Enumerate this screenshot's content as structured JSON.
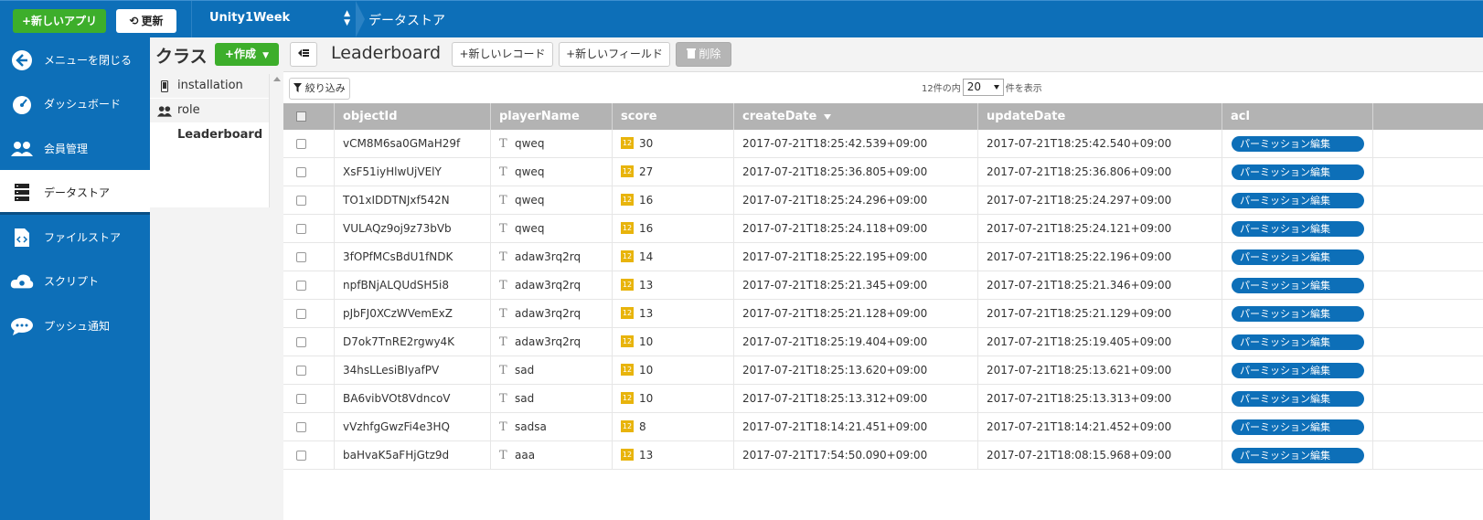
{
  "topbar": {
    "new_app_label": "+新しいアプリ",
    "refresh_label": "更新",
    "app_name": "Unity1Week",
    "breadcrumb": "データストア"
  },
  "sidebar": {
    "items": [
      {
        "label": "メニューを閉じる",
        "icon": "arrow-left-circle-icon"
      },
      {
        "label": "ダッシュボード",
        "icon": "gauge-icon"
      },
      {
        "label": "会員管理",
        "icon": "users-icon"
      },
      {
        "label": "データストア",
        "icon": "database-icon",
        "active": true
      },
      {
        "label": "ファイルストア",
        "icon": "file-code-icon"
      },
      {
        "label": "スクリプト",
        "icon": "cloud-gear-icon"
      },
      {
        "label": "プッシュ通知",
        "icon": "chat-bubble-icon"
      }
    ]
  },
  "classes": {
    "title": "クラス",
    "create_label": "+作成",
    "items": [
      {
        "label": "installation",
        "icon": "phone-icon"
      },
      {
        "label": "role",
        "icon": "users-icon"
      },
      {
        "label": "Leaderboard",
        "icon": "",
        "active": true
      }
    ]
  },
  "toolbar": {
    "title": "Leaderboard",
    "new_record_label": "+新しいレコード",
    "new_field_label": "+新しいフィールド",
    "delete_label": "削除"
  },
  "filter": {
    "filter_label": "絞り込み",
    "count_prefix": "12件の内",
    "per_page": "20",
    "count_suffix": "件を表示"
  },
  "table": {
    "columns": [
      "objectId",
      "playerName",
      "score",
      "createDate",
      "updateDate",
      "acl"
    ],
    "sorted_column": "createDate",
    "acl_button_label": "パーミッション編集",
    "rows": [
      {
        "objectId": "vCM8M6sa0GMaH29f",
        "playerName": "qweq",
        "score": "30",
        "createDate": "2017-07-21T18:25:42.539+09:00",
        "updateDate": "2017-07-21T18:25:42.540+09:00"
      },
      {
        "objectId": "XsF51iyHlwUjVElY",
        "playerName": "qweq",
        "score": "27",
        "createDate": "2017-07-21T18:25:36.805+09:00",
        "updateDate": "2017-07-21T18:25:36.806+09:00"
      },
      {
        "objectId": "TO1xIDDTNJxf542N",
        "playerName": "qweq",
        "score": "16",
        "createDate": "2017-07-21T18:25:24.296+09:00",
        "updateDate": "2017-07-21T18:25:24.297+09:00"
      },
      {
        "objectId": "VULAQz9oj9z73bVb",
        "playerName": "qweq",
        "score": "16",
        "createDate": "2017-07-21T18:25:24.118+09:00",
        "updateDate": "2017-07-21T18:25:24.121+09:00"
      },
      {
        "objectId": "3fOPfMCsBdU1fNDK",
        "playerName": "adaw3rq2rq",
        "score": "14",
        "createDate": "2017-07-21T18:25:22.195+09:00",
        "updateDate": "2017-07-21T18:25:22.196+09:00"
      },
      {
        "objectId": "npfBNjALQUdSH5i8",
        "playerName": "adaw3rq2rq",
        "score": "13",
        "createDate": "2017-07-21T18:25:21.345+09:00",
        "updateDate": "2017-07-21T18:25:21.346+09:00"
      },
      {
        "objectId": "pJbFJ0XCzWVemExZ",
        "playerName": "adaw3rq2rq",
        "score": "13",
        "createDate": "2017-07-21T18:25:21.128+09:00",
        "updateDate": "2017-07-21T18:25:21.129+09:00"
      },
      {
        "objectId": "D7ok7TnRE2rgwy4K",
        "playerName": "adaw3rq2rq",
        "score": "10",
        "createDate": "2017-07-21T18:25:19.404+09:00",
        "updateDate": "2017-07-21T18:25:19.405+09:00"
      },
      {
        "objectId": "34hsLLesiBIyafPV",
        "playerName": "sad",
        "score": "10",
        "createDate": "2017-07-21T18:25:13.620+09:00",
        "updateDate": "2017-07-21T18:25:13.621+09:00"
      },
      {
        "objectId": "BA6vibVOt8VdncoV",
        "playerName": "sad",
        "score": "10",
        "createDate": "2017-07-21T18:25:13.312+09:00",
        "updateDate": "2017-07-21T18:25:13.313+09:00"
      },
      {
        "objectId": "vVzhfgGwzFi4e3HQ",
        "playerName": "sadsa",
        "score": "8",
        "createDate": "2017-07-21T18:14:21.451+09:00",
        "updateDate": "2017-07-21T18:14:21.452+09:00"
      },
      {
        "objectId": "baHvaK5aFHjGtz9d",
        "playerName": "aaa",
        "score": "13",
        "createDate": "2017-07-21T17:54:50.090+09:00",
        "updateDate": "2017-07-21T18:08:15.968+09:00"
      }
    ]
  },
  "colors": {
    "brand_blue": "#0d6fb8",
    "action_green": "#3dae2b",
    "number_badge": "#e8b40c",
    "header_gray": "#b3b3b3"
  }
}
